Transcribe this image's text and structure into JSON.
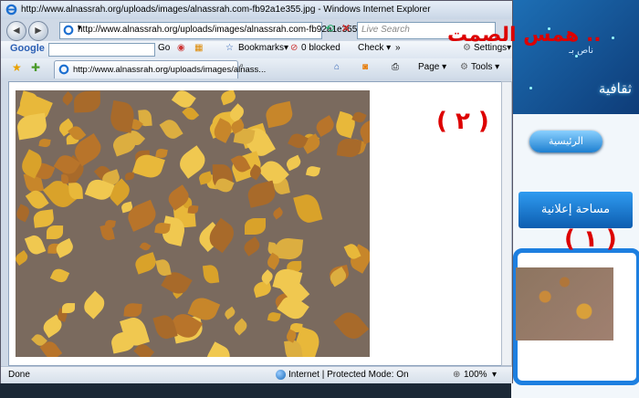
{
  "window": {
    "title": "http://www.alnassrah.org/uploads/images/alnassrah.com-fb92a1e355.jpg - Windows Internet Explorer",
    "minimize": "–",
    "maximize": "□",
    "close": "✕"
  },
  "nav": {
    "back": "◄",
    "forward": "►",
    "address": "http://www.alnassrah.org/uploads/images/alnassrah.com-fb92a1e355.jpg",
    "search_placeholder": "Live Search"
  },
  "google_toolbar": {
    "logo": "Google",
    "go": "Go",
    "bookmarks": "Bookmarks▾",
    "blocked": "0 blocked",
    "check": "Check ▾",
    "more": "»",
    "settings": "Settings▾"
  },
  "tab_bar": {
    "favorites_icon": "star-icon",
    "tab_label": "http://www.alnassrah.org/uploads/images/alnass...",
    "page": "Page ▾",
    "tools": "Tools ▾"
  },
  "status": {
    "left": "Done",
    "zone": "Internet | Protected Mode: On",
    "zoom": "100%"
  },
  "annotations": {
    "top": "همس الصمت ..",
    "one": "( ١ )",
    "two": "( ٢ )"
  },
  "background_site": {
    "header_text": "ثقافية",
    "header_small": "ناص بـ",
    "home_button": "الرئيسية",
    "ad_button": "مساحة إعلانية"
  },
  "colors": {
    "annotation_red": "#dd0000",
    "site_blue": "#1d7fe0"
  }
}
